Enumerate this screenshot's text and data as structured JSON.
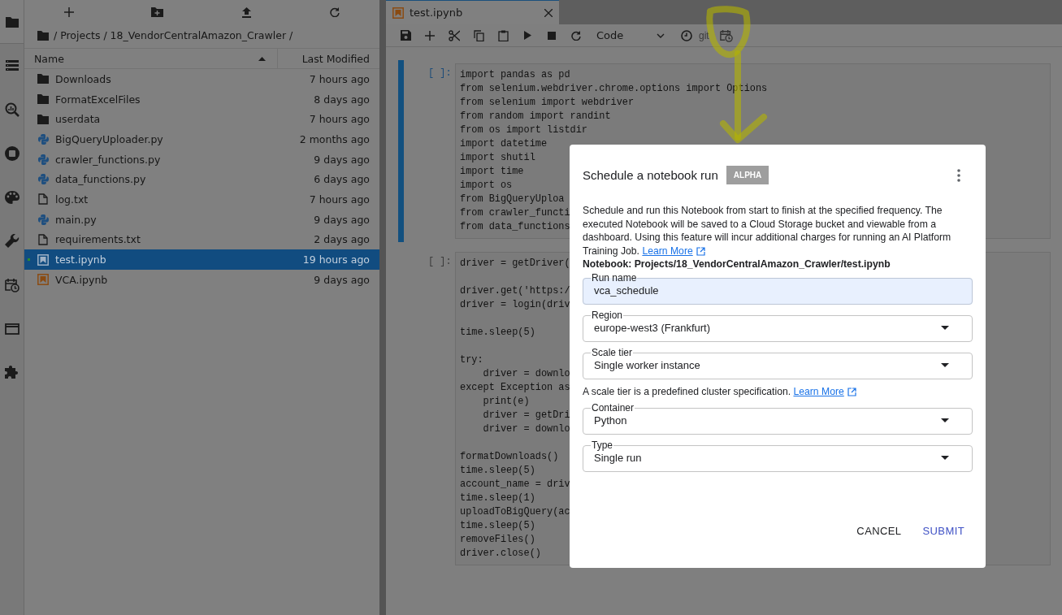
{
  "activity_bar": {
    "items": [
      {
        "kind": "folder",
        "selected": true
      },
      {
        "kind": "list",
        "selected": false
      },
      {
        "kind": "search",
        "selected": false
      },
      {
        "kind": "stop",
        "selected": false
      },
      {
        "kind": "palette",
        "selected": false
      },
      {
        "kind": "wrench",
        "selected": false
      },
      {
        "kind": "calendar",
        "selected": false
      },
      {
        "kind": "window",
        "selected": false
      },
      {
        "kind": "puzzle",
        "selected": false
      }
    ]
  },
  "file_browser": {
    "breadcrumb": "/ Projects / 18_VendorCentralAmazon_Crawler /",
    "columns": [
      "Name",
      "Last Modified"
    ],
    "rows": [
      {
        "name": "Downloads",
        "modified": "7 hours ago",
        "kind": "folder",
        "selected": false,
        "running": false
      },
      {
        "name": "FormatExcelFiles",
        "modified": "8 days ago",
        "kind": "folder",
        "selected": false,
        "running": false
      },
      {
        "name": "userdata",
        "modified": "7 hours ago",
        "kind": "folder",
        "selected": false,
        "running": false
      },
      {
        "name": "BigQueryUploader.py",
        "modified": "2 months ago",
        "kind": "python",
        "selected": false,
        "running": false
      },
      {
        "name": "crawler_functions.py",
        "modified": "9 days ago",
        "kind": "python",
        "selected": false,
        "running": false
      },
      {
        "name": "data_functions.py",
        "modified": "6 days ago",
        "kind": "python",
        "selected": false,
        "running": false
      },
      {
        "name": "log.txt",
        "modified": "7 hours ago",
        "kind": "text",
        "selected": false,
        "running": false
      },
      {
        "name": "main.py",
        "modified": "9 days ago",
        "kind": "python",
        "selected": false,
        "running": false
      },
      {
        "name": "requirements.txt",
        "modified": "2 days ago",
        "kind": "text",
        "selected": false,
        "running": false
      },
      {
        "name": "test.ipynb",
        "modified": "19 hours ago",
        "kind": "notebook",
        "selected": true,
        "running": true
      },
      {
        "name": "VCA.ipynb",
        "modified": "9 days ago",
        "kind": "notebook",
        "selected": false,
        "running": false
      }
    ]
  },
  "notebook": {
    "tab": {
      "title": "test.ipynb"
    },
    "toolbar": {
      "cell_type": "Code",
      "git": "git"
    },
    "cells": [
      {
        "prompt": "[ ]:",
        "selected": true,
        "blocks": [
          [
            "import pandas as pd",
            "from selenium.webdriver.chrome.options import Options",
            "from selenium import webdriver",
            "from random import randint",
            "from os import listdir",
            "import datetime",
            "import shutil",
            "import time",
            "import os",
            "from BigQueryUploa",
            "from crawler_functi",
            "from data_functions"
          ]
        ]
      },
      {
        "prompt": "[ ]:",
        "selected": false,
        "blocks": [
          [
            "driver = getDriver("
          ],
          [
            "driver.get('https:/",
            "driver = login(driv"
          ],
          [
            "time.sleep(5)"
          ],
          [
            "try:",
            "    driver = downlo",
            "except Exception as",
            "    print(e)",
            "    driver = getDri",
            "    driver = downlo"
          ],
          [
            "formatDownloads()",
            "time.sleep(5)",
            "account_name = driv",
            "time.sleep(1)",
            "uploadToBigQuery(ac",
            "time.sleep(5)",
            "removeFiles()",
            "driver.close()"
          ]
        ]
      }
    ]
  },
  "dialog": {
    "title": "Schedule a notebook run",
    "badge": "ALPHA",
    "description": "Schedule and run this Notebook from start to finish at the specified frequency. The executed Notebook will be saved to a Cloud Storage bucket and viewable from a dashboard. Using this feature will incur additional charges for running an AI Platform Training Job.",
    "link": "Learn More",
    "notebook_path": "Notebook: Projects/18_VendorCentralAmazon_Crawler/test.ipynb",
    "fields": [
      {
        "label": "Run name",
        "value": "vca_schedule",
        "kind": "text"
      },
      {
        "label": "Region",
        "value": "europe-west3 (Frankfurt)",
        "kind": "select"
      },
      {
        "label": "Scale tier",
        "value": "Single worker instance",
        "kind": "select",
        "help": "A scale tier is a predefined cluster specification.",
        "help_link": "Learn More"
      },
      {
        "label": "Container",
        "value": "Python",
        "kind": "select"
      },
      {
        "label": "Type",
        "value": "Single run",
        "kind": "select"
      }
    ],
    "buttons": [
      {
        "label": "CANCEL",
        "primary": false
      },
      {
        "label": "SUBMIT",
        "primary": true
      }
    ]
  }
}
